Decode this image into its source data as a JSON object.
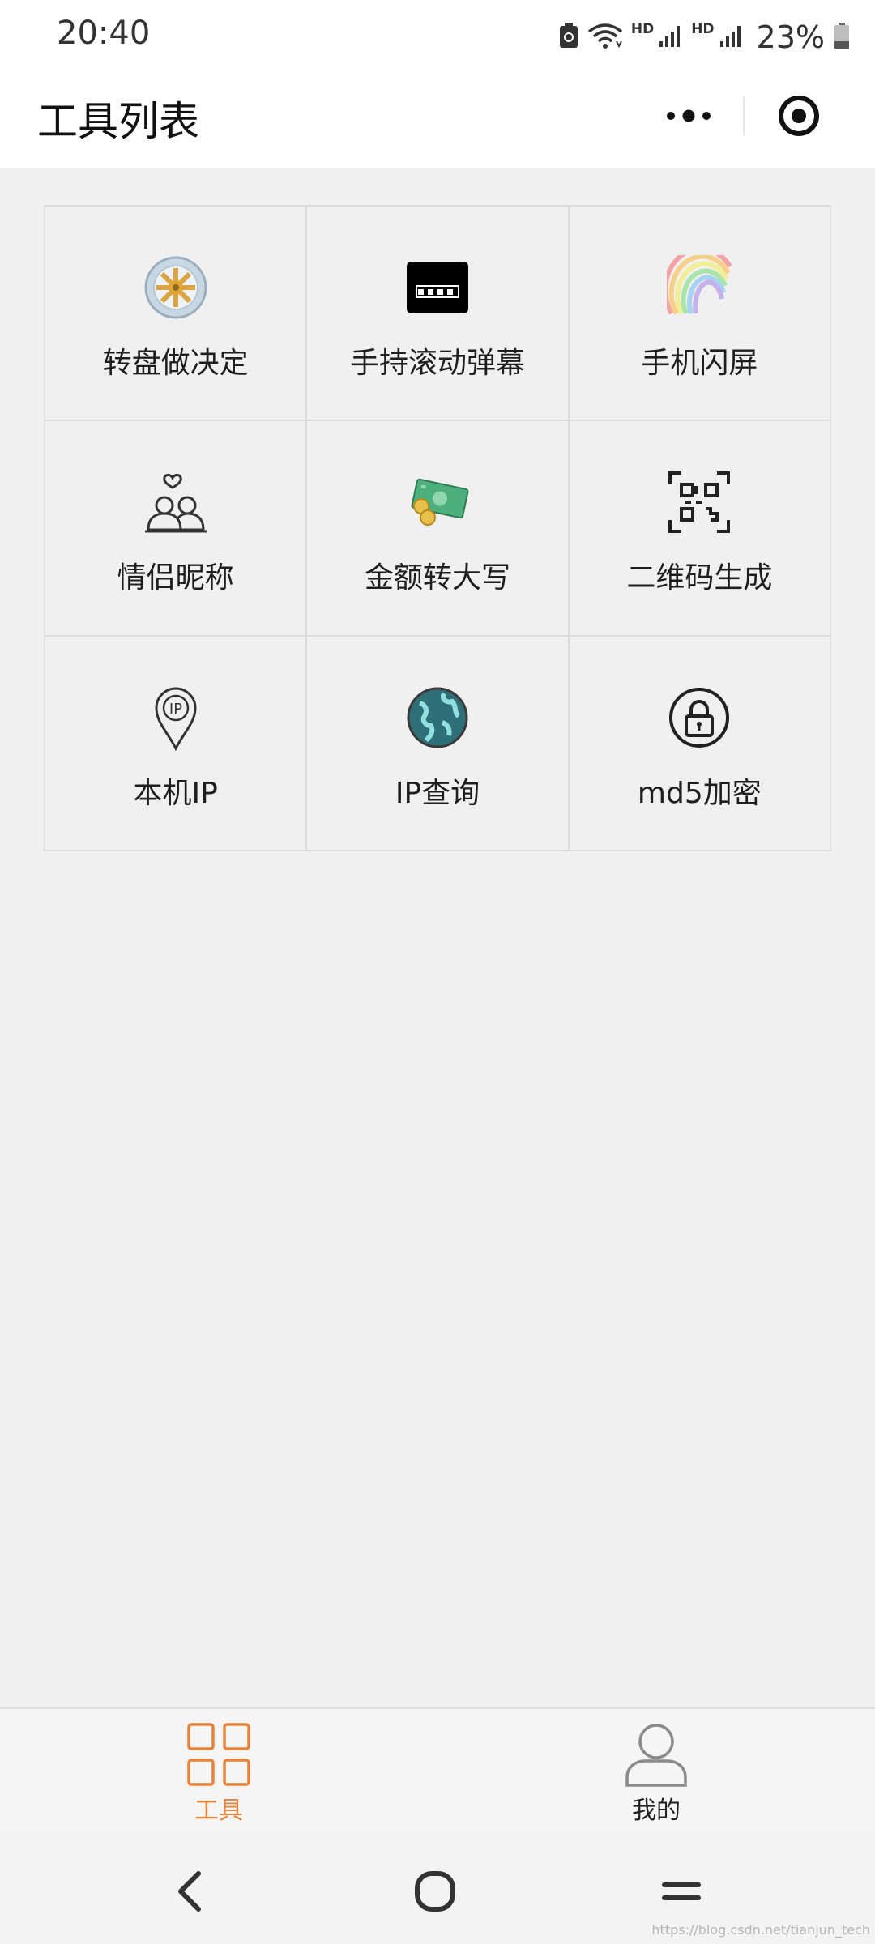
{
  "status_bar": {
    "time": "20:40",
    "network_1": "HD",
    "network_2": "HD",
    "battery": "23%"
  },
  "header": {
    "title": "工具列表"
  },
  "tools": [
    {
      "label": "转盘做决定",
      "icon": "wheel-icon"
    },
    {
      "label": "手持滚动弹幕",
      "icon": "chat-bubble-icon"
    },
    {
      "label": "手机闪屏",
      "icon": "rainbow-icon"
    },
    {
      "label": "情侣昵称",
      "icon": "couple-icon"
    },
    {
      "label": "金额转大写",
      "icon": "money-icon"
    },
    {
      "label": "二维码生成",
      "icon": "qr-code-icon"
    },
    {
      "label": "本机IP",
      "icon": "location-pin-icon"
    },
    {
      "label": "IP查询",
      "icon": "globe-icon"
    },
    {
      "label": "md5加密",
      "icon": "lock-icon"
    }
  ],
  "tab_bar": {
    "tabs": [
      {
        "label": "工具",
        "icon": "grid-icon",
        "active": true
      },
      {
        "label": "我的",
        "icon": "user-icon",
        "active": false
      }
    ]
  },
  "watermark": "https://blog.csdn.net/tianjun_tech",
  "colors": {
    "accent": "#e8833a",
    "background": "#f1f0f1",
    "grid_line": "#dcdcdc"
  }
}
